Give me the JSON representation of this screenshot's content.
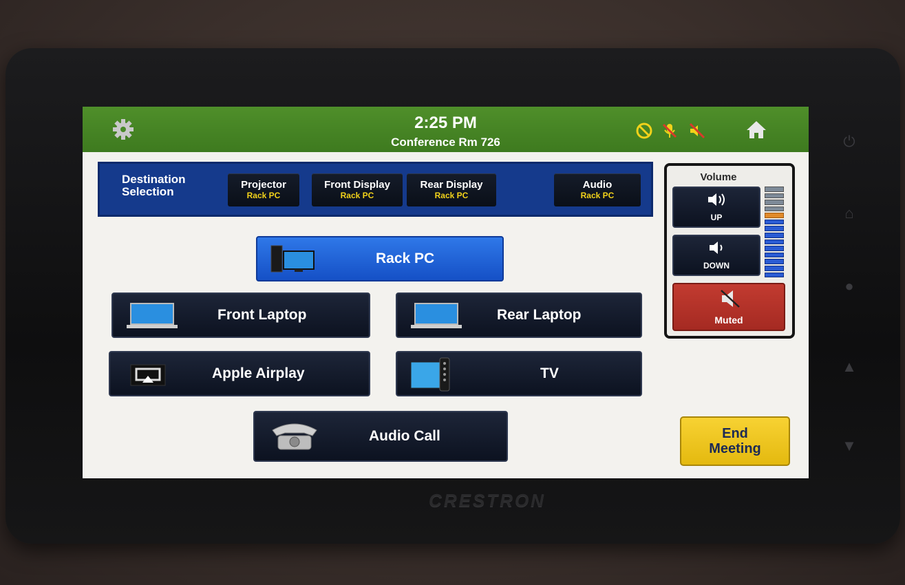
{
  "header": {
    "time": "2:25 PM",
    "room": "Conference Rm 726"
  },
  "destinations": {
    "title_line1": "Destination",
    "title_line2": "Selection",
    "items": [
      {
        "name": "Projector",
        "source": "Rack PC"
      },
      {
        "name": "Front Display",
        "source": "Rack PC"
      },
      {
        "name": "Rear Display",
        "source": "Rack PC"
      },
      {
        "name": "Audio",
        "source": "Rack PC"
      }
    ]
  },
  "sources": [
    {
      "label": "Rack PC",
      "icon": "desktop-pc-icon",
      "selected": true
    },
    {
      "label": "Front Laptop",
      "icon": "laptop-icon"
    },
    {
      "label": "Rear Laptop",
      "icon": "laptop-icon"
    },
    {
      "label": "Apple Airplay",
      "icon": "airplay-icon"
    },
    {
      "label": "TV",
      "icon": "tv-remote-icon"
    },
    {
      "label": "Audio Call",
      "icon": "telephone-icon"
    }
  ],
  "volume": {
    "title": "Volume",
    "up_label": "UP",
    "down_label": "DOWN",
    "mute_label": "Muted",
    "muted": true
  },
  "end_meeting": {
    "line1": "End",
    "line2": "Meeting"
  },
  "status_icons": [
    "no-call-icon",
    "mic-muted-icon",
    "speaker-muted-icon"
  ],
  "colors": {
    "topbar": "#4f8f2a",
    "destination_bar": "#153a8c",
    "selected_source": "#2f78e8",
    "button": "#1d2538",
    "mute": "#c23b30",
    "end_meeting": "#f7d233",
    "source_text": "#f2d21a"
  },
  "device": {
    "brand": "CRESTRON"
  }
}
